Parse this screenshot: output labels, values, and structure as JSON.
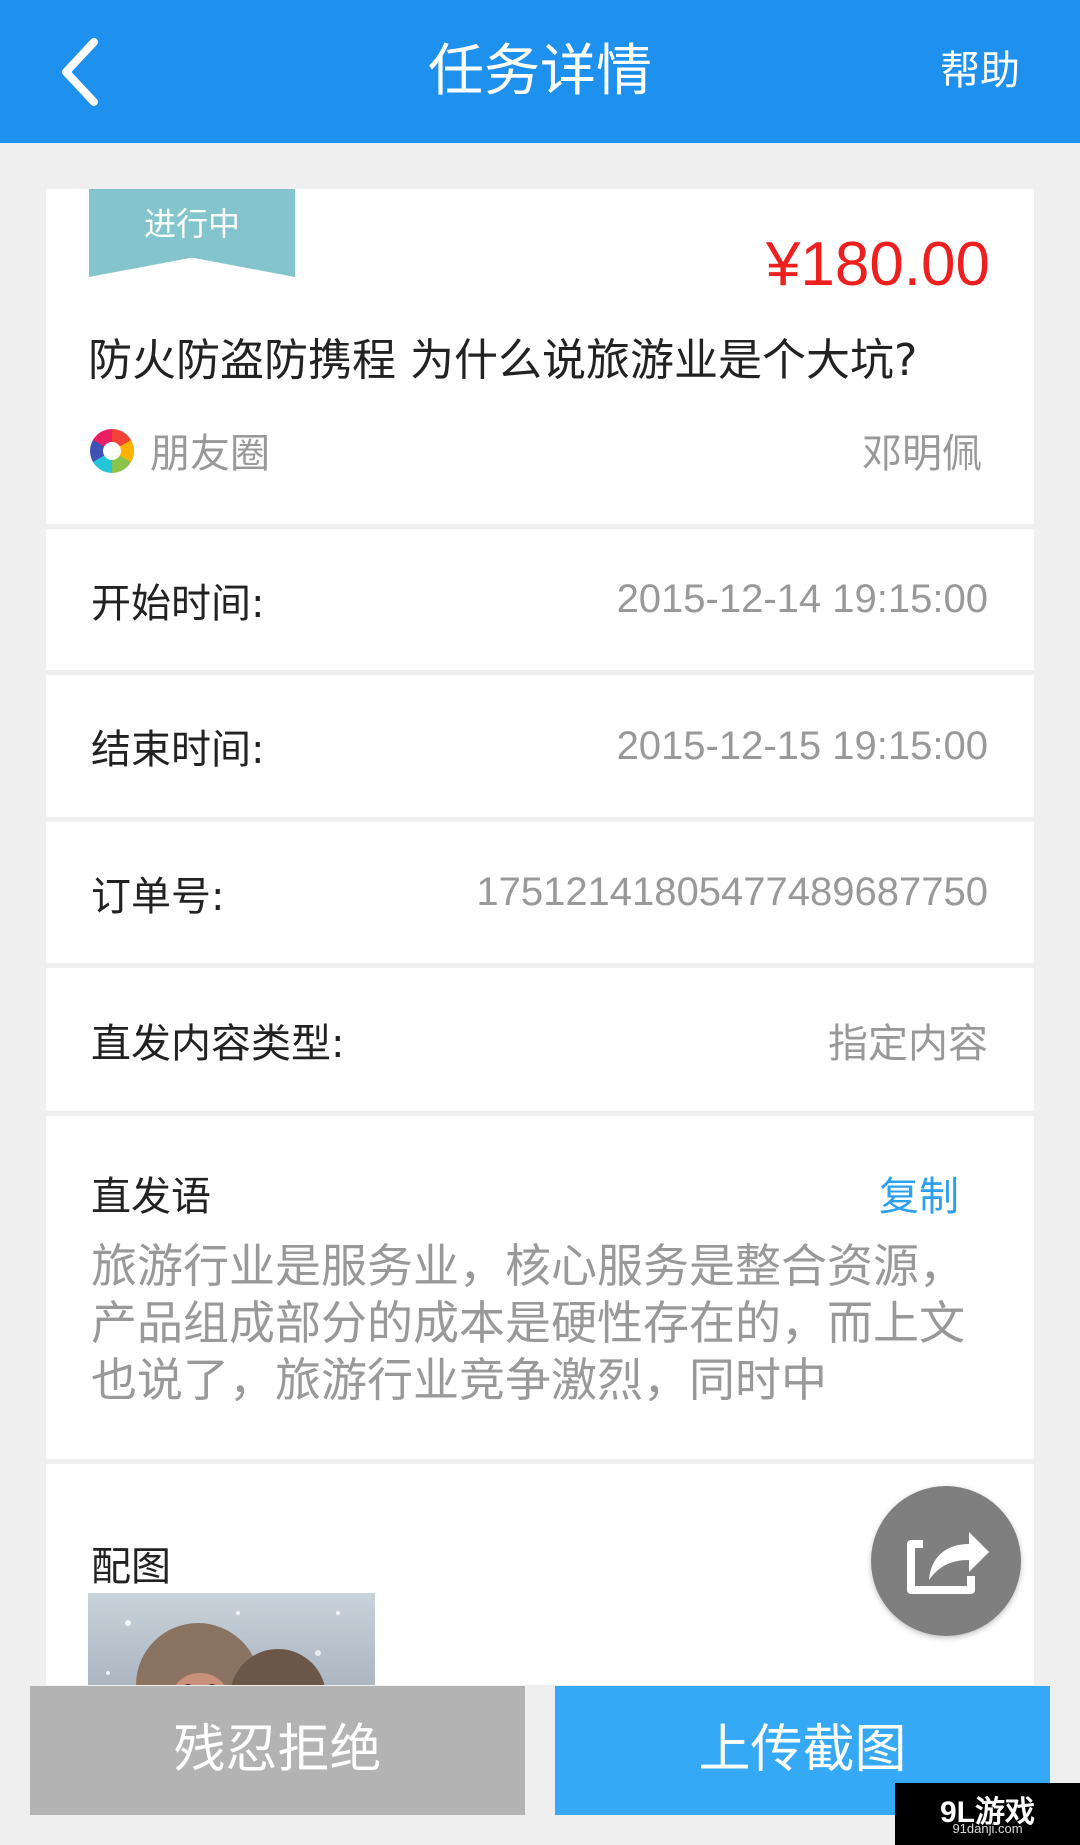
{
  "header": {
    "title": "任务详情",
    "help_label": "帮助",
    "back_icon": "chevron-left-icon"
  },
  "task": {
    "status_badge": "进行中",
    "price": "¥180.00",
    "title": "防火防盗防携程 为什么说旅游业是个大坑?",
    "platform_icon": "wechat-moments-icon",
    "platform_name": "朋友圈",
    "owner_name": "邓明佩"
  },
  "details": [
    {
      "label": "开始时间:",
      "value": "2015-12-14 19:15:00"
    },
    {
      "label": "结束时间:",
      "value": "2015-12-15 19:15:00"
    },
    {
      "label": "订单号:",
      "value": "17512141805477489687750"
    },
    {
      "label": "直发内容类型:",
      "value": "指定内容"
    }
  ],
  "message": {
    "label": "直发语",
    "copy_label": "复制",
    "text": "旅游行业是服务业，核心服务是整合资源，产品组成部分的成本是硬性存在的，而上文也说了，旅游行业竞争激烈，同时中"
  },
  "images": {
    "label": "配图"
  },
  "share_icon": "share-icon",
  "actions": {
    "reject_label": "残忍拒绝",
    "upload_label": "上传截图"
  },
  "watermark": {
    "main": "9L游戏",
    "sub": "91danji.com"
  },
  "colors": {
    "primary": "#1e90ee",
    "price": "#ee1f1f",
    "badge": "#84c5cd",
    "copy_link": "#2ba0ef",
    "reject_button": "#b3b3b3",
    "upload_button": "#35a9f5"
  }
}
